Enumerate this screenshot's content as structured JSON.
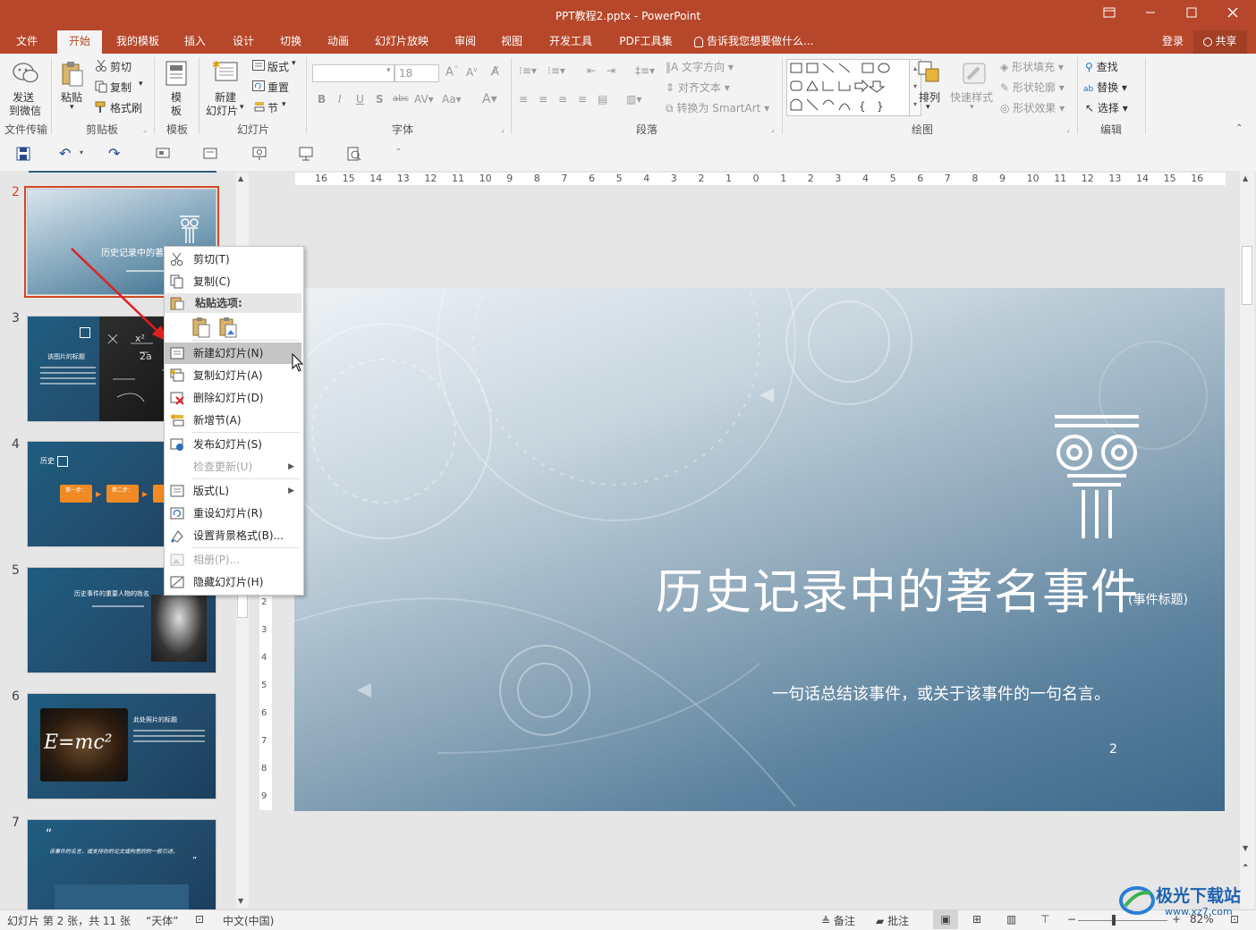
{
  "window": {
    "title": "PPT教程2.pptx - PowerPoint",
    "controls": [
      "restore-ribbon",
      "minimize",
      "maximize",
      "close"
    ]
  },
  "tabs": {
    "items": [
      {
        "label": "文件"
      },
      {
        "label": "开始"
      },
      {
        "label": "我的模板"
      },
      {
        "label": "插入"
      },
      {
        "label": "设计"
      },
      {
        "label": "切换"
      },
      {
        "label": "动画"
      },
      {
        "label": "幻灯片放映"
      },
      {
        "label": "审阅"
      },
      {
        "label": "视图"
      },
      {
        "label": "开发工具"
      },
      {
        "label": "PDF工具集"
      }
    ],
    "active": "开始",
    "tell_me": "告诉我您想要做什么...",
    "login": "登录",
    "share": "共享"
  },
  "ribbon": {
    "file_transfer": {
      "button": [
        "发送",
        "到微信"
      ],
      "group": "文件传输"
    },
    "clipboard": {
      "paste": "粘贴",
      "cut": "剪切",
      "copy": "复制",
      "format_painter": "格式刷",
      "group": "剪贴板"
    },
    "template": {
      "button": [
        "模",
        "板"
      ],
      "group": "模板"
    },
    "slides": {
      "new_slide": [
        "新建",
        "幻灯片"
      ],
      "layout": "版式",
      "reset": "重置",
      "section": "节",
      "group": "幻灯片"
    },
    "font": {
      "font_size": "18",
      "group": "字体",
      "change_case": "Aa"
    },
    "paragraph": {
      "text_direction": "文字方向",
      "align_text": "对齐文本",
      "smartart": "转换为 SmartArt",
      "group": "段落"
    },
    "drawing": {
      "arrange": "排列",
      "quick_styles": "快速样式",
      "shape_fill": "形状填充",
      "shape_outline": "形状轮廓",
      "shape_effects": "形状效果",
      "group": "绘图"
    },
    "editing": {
      "find": "查找",
      "replace": "替换",
      "select": "选择",
      "group": "编辑"
    }
  },
  "ruler": {
    "marks": [
      "16",
      "15",
      "14",
      "13",
      "12",
      "11",
      "10",
      "9",
      "8",
      "7",
      "6",
      "5",
      "4",
      "3",
      "2",
      "1",
      "0",
      "1",
      "2",
      "3",
      "4",
      "5",
      "6",
      "7",
      "8",
      "9",
      "10",
      "11",
      "12",
      "13",
      "14",
      "15",
      "16"
    ],
    "vmarks": [
      "2",
      "3",
      "4",
      "5",
      "6",
      "7",
      "8",
      "9"
    ]
  },
  "thumbnails": [
    {
      "num": "2",
      "title": "历史记录中的著",
      "selected": true
    },
    {
      "num": "3",
      "title": "该图片的标题"
    },
    {
      "num": "4",
      "title": "历史",
      "steps": [
        "第一步：",
        "第二步："
      ]
    },
    {
      "num": "5",
      "title": "历史事件的重要人物的姓名"
    },
    {
      "num": "6",
      "title": "此处照片的标题",
      "formula": "E=mc²"
    },
    {
      "num": "7",
      "quote": "该事件的名言，或支持你的论文或构思的的一般引述。"
    }
  ],
  "context_menu": {
    "items": [
      {
        "label": "剪切(T)",
        "icon": "scissors-icon"
      },
      {
        "label": "复制(C)",
        "icon": "copy-icon"
      },
      {
        "header": "粘贴选项:",
        "icon": "paste-icon"
      },
      {
        "label": "新建幻灯片(N)",
        "icon": "new-slide-icon",
        "highlighted": true
      },
      {
        "label": "复制幻灯片(A)",
        "icon": "duplicate-slide-icon"
      },
      {
        "label": "删除幻灯片(D)",
        "icon": "delete-slide-icon"
      },
      {
        "label": "新增节(A)",
        "icon": "add-section-icon"
      },
      {
        "label": "发布幻灯片(S)",
        "icon": "publish-slides-icon"
      },
      {
        "label": "检查更新(U)",
        "disabled": true,
        "submenu": true
      },
      {
        "label": "版式(L)",
        "icon": "layout-icon",
        "submenu": true
      },
      {
        "label": "重设幻灯片(R)",
        "icon": "reset-slide-icon"
      },
      {
        "label": "设置背景格式(B)...",
        "icon": "format-background-icon"
      },
      {
        "label": "相册(P)...",
        "icon": "photo-album-icon",
        "disabled": true
      },
      {
        "label": "隐藏幻灯片(H)",
        "icon": "hide-slide-icon"
      }
    ]
  },
  "slide": {
    "title": "历史记录中的著名事件",
    "subtitle": "(事件标题)",
    "quote": "一句话总结该事件，或关于该事件的一句名言。",
    "number": "2"
  },
  "status_bar": {
    "slide_info": "幻灯片 第 2 张，共 11 张",
    "theme": "“天体”",
    "language": "中文(中国)",
    "notes": "备注",
    "comments": "批注",
    "zoom": "82%"
  },
  "watermark": {
    "text": "极光下载站",
    "url": "www.xz7.com"
  },
  "colors": {
    "accent": "#b7472a",
    "selection": "#d24726",
    "annotation_arrow": "#e02020"
  }
}
